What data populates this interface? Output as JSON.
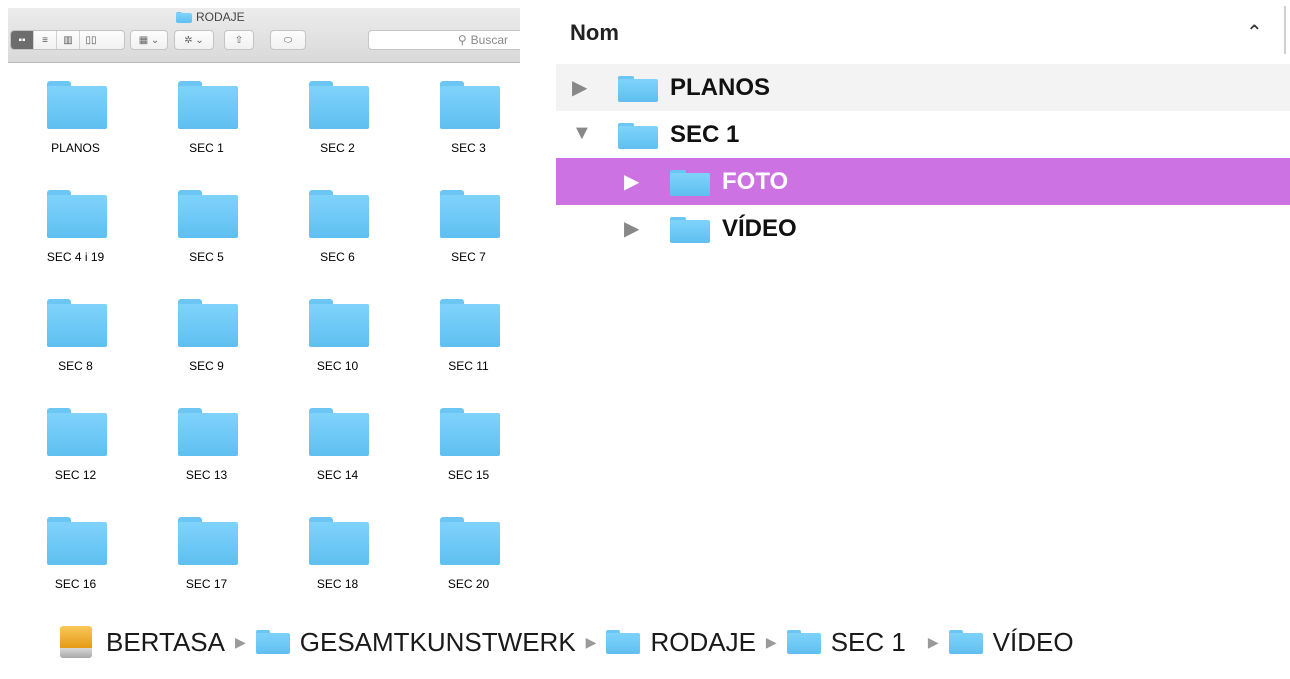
{
  "finder": {
    "window_title": "RODAJE",
    "search_placeholder": "Buscar",
    "view_buttons": [
      "icon-view",
      "list-view",
      "column-view",
      "cover-flow-view"
    ],
    "items": [
      "PLANOS",
      "SEC 1",
      "SEC 2",
      "SEC 3",
      "SEC 4 i 19",
      "SEC 5",
      "SEC 6",
      "SEC 7",
      "SEC 8",
      "SEC 9",
      "SEC 10",
      "SEC 11",
      "SEC 12",
      "SEC 13",
      "SEC 14",
      "SEC 15",
      "SEC 16",
      "SEC 17",
      "SEC 18",
      "SEC 20"
    ]
  },
  "listview": {
    "column_header": "Nom",
    "sort_indicator": "^",
    "rows": [
      {
        "label": "PLANOS",
        "expanded": false,
        "selected": false
      },
      {
        "label": "SEC 1",
        "expanded": true,
        "selected": false
      },
      {
        "label": "FOTO",
        "expanded": false,
        "selected": true
      },
      {
        "label": "VÍDEO",
        "expanded": false,
        "selected": false
      }
    ],
    "selection_color": "#cc72e3"
  },
  "pathbar": {
    "crumbs": [
      "BERTASA",
      "GESAMTKUNSTWERK",
      "RODAJE",
      "SEC 1",
      "VÍDEO"
    ]
  },
  "colors": {
    "folder_blue": "#6cc6f3",
    "drive_orange": "#f0ad2e"
  }
}
